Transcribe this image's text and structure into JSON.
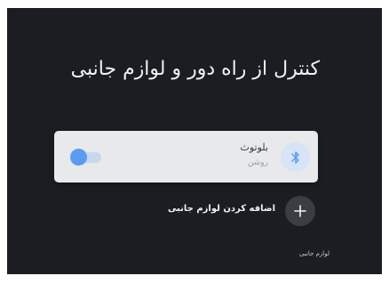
{
  "title": "کنترل از راه دور و لوازم جانبی",
  "bluetooth": {
    "label": "بلوتوث",
    "status": "روشن",
    "enabled": true,
    "icon": "bluetooth-icon"
  },
  "add_accessory": {
    "label": "اضافه کردن لوازم جانبی",
    "icon": "plus-icon"
  },
  "section_label": "لوازم جانبی",
  "colors": {
    "background": "#1b1d22",
    "card": "#e8e9eb",
    "accent": "#5a9cf0"
  }
}
